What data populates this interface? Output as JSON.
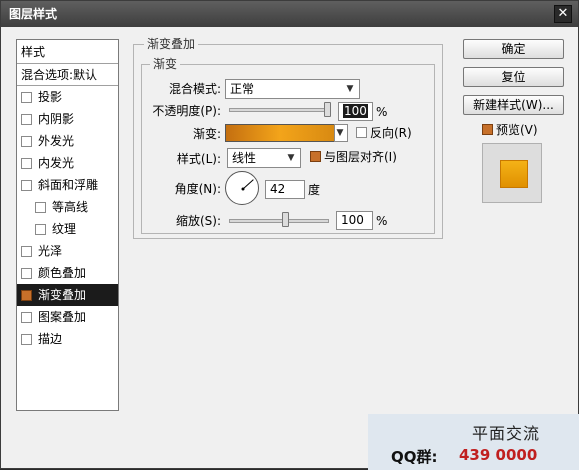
{
  "window": {
    "title": "图层样式",
    "close_glyph": "✕"
  },
  "stylelist": {
    "header": "样式",
    "blend_options": "混合选项:默认",
    "items": [
      {
        "label": "投影",
        "checked": false,
        "sub": false,
        "active": false
      },
      {
        "label": "内阴影",
        "checked": false,
        "sub": false,
        "active": false
      },
      {
        "label": "外发光",
        "checked": false,
        "sub": false,
        "active": false
      },
      {
        "label": "内发光",
        "checked": false,
        "sub": false,
        "active": false
      },
      {
        "label": "斜面和浮雕",
        "checked": false,
        "sub": false,
        "active": false
      },
      {
        "label": "等高线",
        "checked": false,
        "sub": true,
        "active": false
      },
      {
        "label": "纹理",
        "checked": false,
        "sub": true,
        "active": false
      },
      {
        "label": "光泽",
        "checked": false,
        "sub": false,
        "active": false
      },
      {
        "label": "颜色叠加",
        "checked": false,
        "sub": false,
        "active": false
      },
      {
        "label": "渐变叠加",
        "checked": true,
        "sub": false,
        "active": true
      },
      {
        "label": "图案叠加",
        "checked": false,
        "sub": false,
        "active": false
      },
      {
        "label": "描边",
        "checked": false,
        "sub": false,
        "active": false
      }
    ]
  },
  "panel": {
    "outer_title": "渐变叠加",
    "inner_title": "渐变",
    "blend_mode_label": "混合模式:",
    "blend_mode_value": "正常",
    "opacity_label": "不透明度(P):",
    "opacity_value": "100",
    "opacity_unit": "%",
    "opacity_level": 1.0,
    "gradient_label": "渐变:",
    "reverse_label": "反向(R)",
    "reverse_checked": false,
    "style_label": "样式(L):",
    "style_value": "线性",
    "align_label": "与图层对齐(I)",
    "align_checked": true,
    "angle_label": "角度(N):",
    "angle_value": "42",
    "angle_unit": "度",
    "scale_label": "缩放(S):",
    "scale_value": "100",
    "scale_unit": "%",
    "scale_level": 0.6
  },
  "buttons": {
    "ok": "确定",
    "reset": "复位",
    "new_style": "新建样式(W)...",
    "preview_label": "预览(V)",
    "preview_checked": true
  },
  "watermark": {
    "title": "平面交流",
    "qq_label": "QQ群:",
    "qq_number": "439 0000"
  },
  "colors": {
    "accent": "#c7702a",
    "gradient_start": "#c46f10",
    "gradient_mid": "#f3a41a",
    "selection": "#1b1b1b"
  }
}
